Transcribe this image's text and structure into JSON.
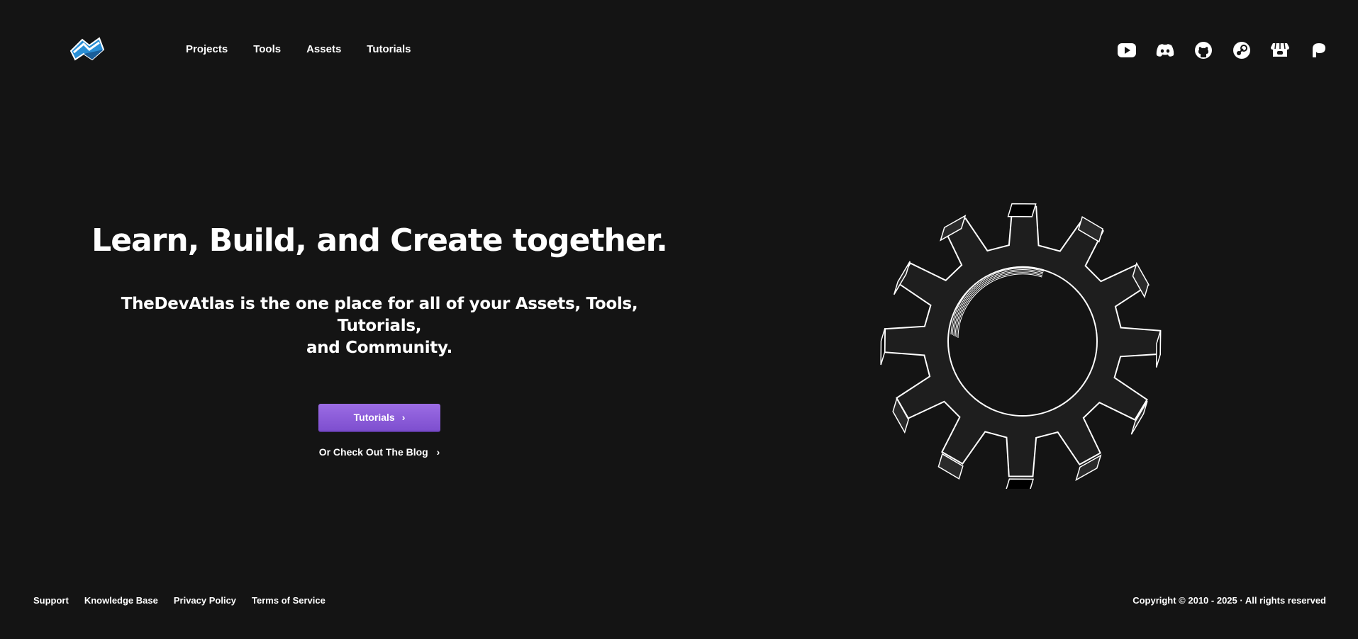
{
  "header": {
    "logo_icon": "devatlas-logo-icon",
    "nav": [
      "Projects",
      "Tools",
      "Assets",
      "Tutorials"
    ],
    "social_icons": [
      "youtube-icon",
      "discord-icon",
      "github-icon",
      "steam-icon",
      "itchio-icon",
      "patreon-icon"
    ]
  },
  "hero": {
    "title": "Learn, Build, and Create together.",
    "subtitle_line1": "TheDevAtlas is the one place for all of your Assets, Tools, Tutorials,",
    "subtitle_line2": "and Community.",
    "cta_label": "Tutorials",
    "cta_chevron": "›",
    "blog_link": "Or Check Out The Blog",
    "blog_chevron": "›",
    "illustration_icon": "gear-icon",
    "accent_color": "#8a5cdb"
  },
  "footer": {
    "links": [
      "Support",
      "Knowledge Base",
      "Privacy Policy",
      "Terms of Service"
    ],
    "copyright": "Copyright © 2010 - 2025 · All rights reserved"
  }
}
